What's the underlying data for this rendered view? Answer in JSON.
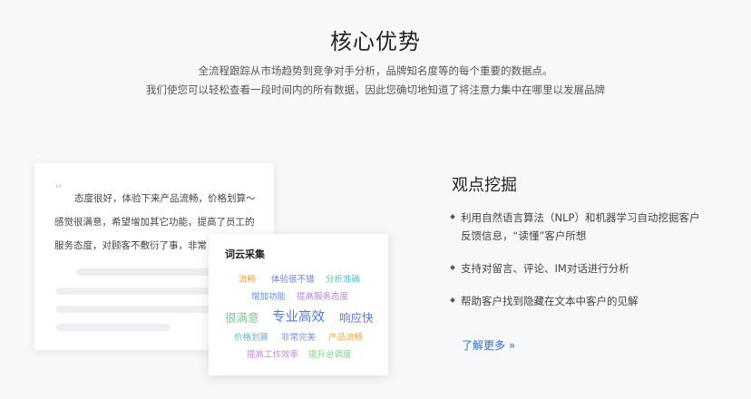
{
  "header": {
    "title": "核心优势",
    "subtitle_line1": "全流程跟踪从市场趋势到竞争对手分析，品牌知名度等的每个重要的数据点。",
    "subtitle_line2": "我们使您可以轻松查看一段时间内的所有数据，因此您确切地知道了将注意力集中在哪里以发展品牌"
  },
  "review": {
    "quote_icon": "quote-mark-icon",
    "line1": "态度很好，体验下来产品流畅，价格划算～",
    "line2": "感觉很满意，希望增加其它功能，提高了员工的",
    "line3": "服务态度，对顾客不敷衍了事，非常"
  },
  "word_cloud": {
    "title": "词云采集",
    "words": [
      {
        "text": "流畅",
        "color": "#f0a04b"
      },
      {
        "text": "体验很不错",
        "color": "#6a7ee8"
      },
      {
        "text": "分析准确",
        "color": "#4cc3c9"
      },
      {
        "text": "增加功能",
        "color": "#5b8def"
      },
      {
        "text": "提高服务态度",
        "color": "#b684e0"
      },
      {
        "text": "很满意",
        "color": "#6ccf8a"
      },
      {
        "text": "专业高效",
        "color": "#4a7be8"
      },
      {
        "text": "响应快",
        "color": "#5b74e8"
      },
      {
        "text": "价格划算",
        "color": "#57b6e6"
      },
      {
        "text": "非常完美",
        "color": "#7b8cf0"
      },
      {
        "text": "产品流畅",
        "color": "#f2a74a"
      },
      {
        "text": "提高工作效率",
        "color": "#c08ae6"
      },
      {
        "text": "提升总调度",
        "color": "#86d08c"
      }
    ]
  },
  "feature": {
    "title": "观点挖掘",
    "item1_line1": "利用自然语言算法（NLP）和机器学习自动挖掘客户",
    "item1_line2": "反馈信息，“读懂”客户所想",
    "item2": "支持对留言、评论、IM对话进行分析",
    "item3": "帮助客户找到隐藏在文本中客户的见解",
    "learn_more": "了解更多 »"
  },
  "colors": {
    "accent": "#2f6fd6",
    "background": "#f7f8fa"
  }
}
